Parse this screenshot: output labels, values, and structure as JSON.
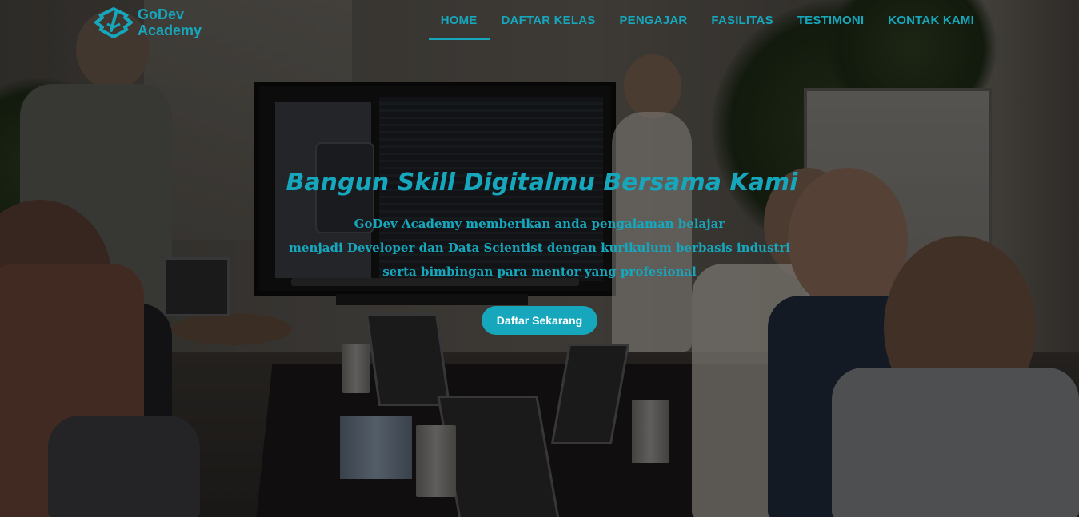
{
  "brand": {
    "name_line1": "GoDev",
    "name_line2": "Academy",
    "logo_icon": "code-box-icon",
    "accent_color": "#16a7bd"
  },
  "nav": {
    "items": [
      {
        "label": "HOME",
        "active": true
      },
      {
        "label": "DAFTAR KELAS",
        "active": false
      },
      {
        "label": "PENGAJAR",
        "active": false
      },
      {
        "label": "FASILITAS",
        "active": false
      },
      {
        "label": "TESTIMONI",
        "active": false
      },
      {
        "label": "KONTAK KAMI",
        "active": false
      }
    ]
  },
  "hero": {
    "title": "Bangun Skill Digitalmu Bersama Kami",
    "subtitle_lines": [
      "GoDev Academy memberikan anda pengalaman belajar",
      "menjadi Developer dan Data Scientist dengan kurikulum berbasis industri",
      "serta bimbingan para mentor yang profesional"
    ],
    "cta_label": "Daftar Sekarang",
    "cta_color": "#16a7bd"
  }
}
